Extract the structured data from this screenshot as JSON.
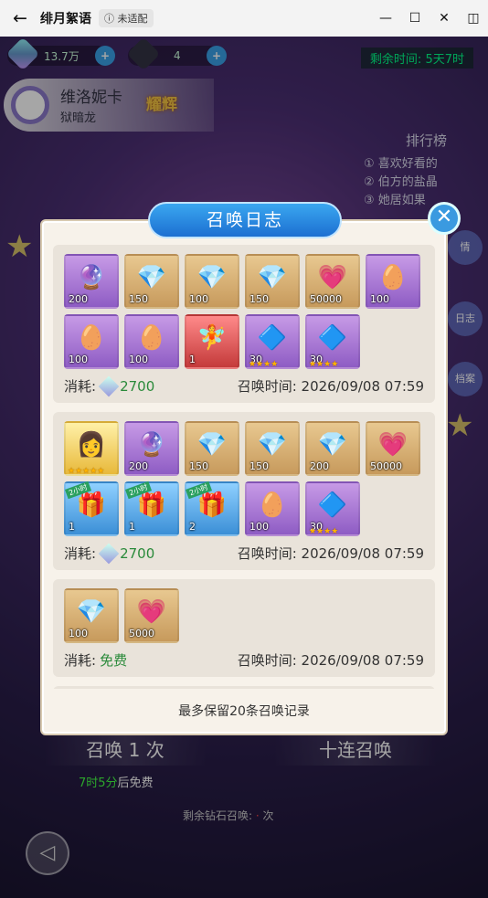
{
  "window": {
    "title": "绯月絮语",
    "badge": "未适配",
    "back": "←",
    "controls": [
      "—",
      "☐",
      "✕",
      "◫"
    ]
  },
  "resources": [
    {
      "value": "13.7万",
      "plus": "+"
    },
    {
      "value": "4",
      "plus": "+"
    }
  ],
  "remain": {
    "label": "剩余时间:",
    "value": "5天7时"
  },
  "hero": {
    "name": "维洛妮卡",
    "sub": "狱暗龙",
    "badge": "耀辉"
  },
  "ranking": {
    "title": "排行榜",
    "items": [
      "喜欢好看的",
      "伯方的盐晶",
      "她居如果"
    ]
  },
  "side_buttons": [
    "情",
    "日志",
    "档案"
  ],
  "bottom": {
    "summon_once": "召唤 1 次",
    "summon_ten": "十连召唤",
    "free_time": "7时5分",
    "free_suffix": "后免费",
    "diamond_left": "剩余钻石召唤:",
    "diamond_unit": "次",
    "back_icon": "◁"
  },
  "dialog": {
    "title": "召唤日志",
    "close": "✕",
    "note": "最多保留20条召唤记录",
    "cost_label": "消耗:",
    "time_label": "召唤时间:"
  },
  "records": [
    {
      "cost": "2700",
      "free": false,
      "time": "2026/09/08 07:59",
      "items": [
        {
          "c": "purple",
          "sym": "🔮",
          "qty": "200"
        },
        {
          "c": "gold",
          "sym": "💎",
          "qty": "150"
        },
        {
          "c": "gold",
          "sym": "💎",
          "qty": "100"
        },
        {
          "c": "gold",
          "sym": "💎",
          "qty": "150"
        },
        {
          "c": "gold",
          "sym": "💗",
          "qty": "50000"
        },
        {
          "c": "purple",
          "sym": "🥚",
          "qty": "100"
        },
        {
          "c": "purple",
          "sym": "🥚",
          "qty": "100"
        },
        {
          "c": "purple",
          "sym": "🥚",
          "qty": "100"
        },
        {
          "c": "red",
          "sym": "🧚",
          "qty": "1"
        },
        {
          "c": "purple",
          "sym": "🔷",
          "qty": "30",
          "stars": "★★★★"
        },
        {
          "c": "purple",
          "sym": "🔷",
          "qty": "30",
          "stars": "★★★★"
        }
      ]
    },
    {
      "cost": "2700",
      "free": false,
      "time": "2026/09/08 07:59",
      "items": [
        {
          "c": "ygold",
          "sym": "👩",
          "qty": "",
          "stars": "★★★★★"
        },
        {
          "c": "purple",
          "sym": "🔮",
          "qty": "200"
        },
        {
          "c": "gold",
          "sym": "💎",
          "qty": "150"
        },
        {
          "c": "gold",
          "sym": "💎",
          "qty": "150"
        },
        {
          "c": "gold",
          "sym": "💎",
          "qty": "200"
        },
        {
          "c": "gold",
          "sym": "💗",
          "qty": "50000"
        },
        {
          "c": "blue",
          "sym": "🎁",
          "qty": "1",
          "tag": "2小时"
        },
        {
          "c": "blue",
          "sym": "🎁",
          "qty": "1",
          "tag": "2小时"
        },
        {
          "c": "blue",
          "sym": "🎁",
          "qty": "2",
          "tag": "2小时"
        },
        {
          "c": "purple",
          "sym": "🥚",
          "qty": "100"
        },
        {
          "c": "purple",
          "sym": "🔷",
          "qty": "30",
          "stars": "★★★★"
        }
      ]
    },
    {
      "cost": "免费",
      "free": true,
      "time": "2026/09/08 07:59",
      "items": [
        {
          "c": "gold",
          "sym": "💎",
          "qty": "100"
        },
        {
          "c": "gold",
          "sym": "💗",
          "qty": "5000"
        }
      ]
    },
    {
      "cost": "",
      "free": false,
      "time": "",
      "items": [
        {
          "c": "red",
          "sym": "👧",
          "qty": ""
        },
        {
          "c": "gold",
          "sym": "💎",
          "qty": ""
        },
        {
          "c": "gold",
          "sym": "💎",
          "qty": ""
        },
        {
          "c": "gold",
          "sym": "💎",
          "qty": ""
        },
        {
          "c": "gold",
          "sym": "💎",
          "qty": ""
        },
        {
          "c": "gold",
          "sym": "💎",
          "qty": ""
        }
      ]
    }
  ]
}
